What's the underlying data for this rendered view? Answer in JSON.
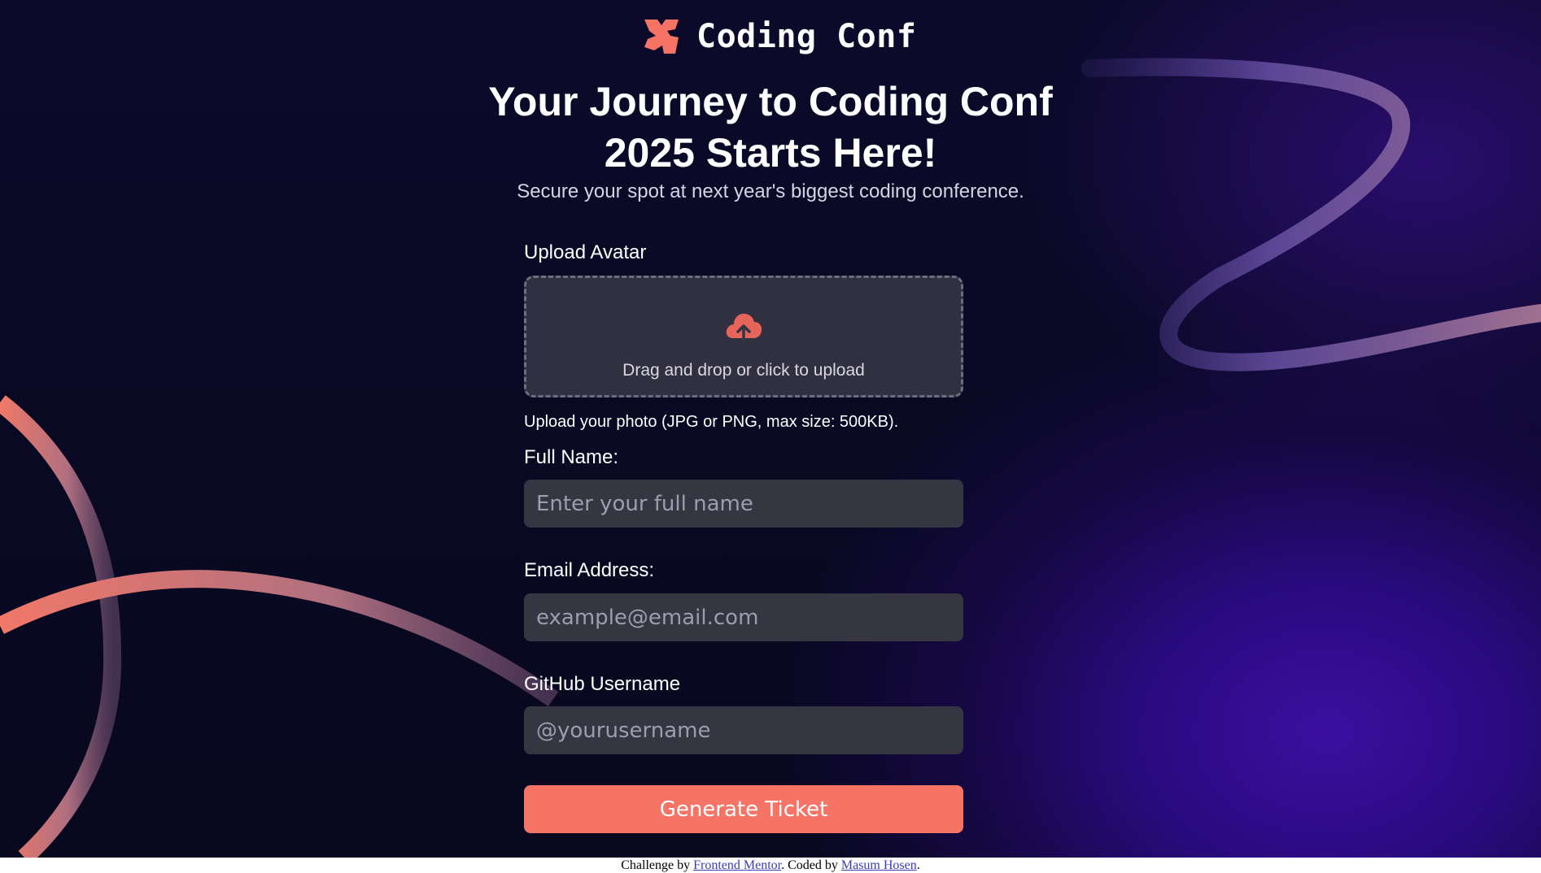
{
  "header": {
    "logo_text": "Coding Conf",
    "headline": "Your Journey to Coding Conf 2025 Starts Here!",
    "subheadline": "Secure your spot at next year's biggest coding conference."
  },
  "form": {
    "avatar_label": "Upload Avatar",
    "upload_prompt": "Drag and drop or click to upload",
    "upload_hint": "Upload your photo (JPG or PNG, max size: 500KB).",
    "name_label": "Full Name:",
    "name_placeholder": "Enter your full name",
    "email_label": "Email Address:",
    "email_placeholder": "example@email.com",
    "github_label": "GitHub Username",
    "github_placeholder": "@yourusername",
    "submit_label": "Generate Ticket"
  },
  "footer": {
    "prefix": "Challenge by ",
    "link1": "Frontend Mentor",
    "middle": ". Coded by ",
    "link2": "Masum Hosen",
    "suffix": "."
  },
  "colors": {
    "accent": "#f57466",
    "background": "#0b0a2a",
    "input_bg": "#363642"
  },
  "icons": [
    "logo-mark-icon",
    "cloud-upload-icon"
  ]
}
